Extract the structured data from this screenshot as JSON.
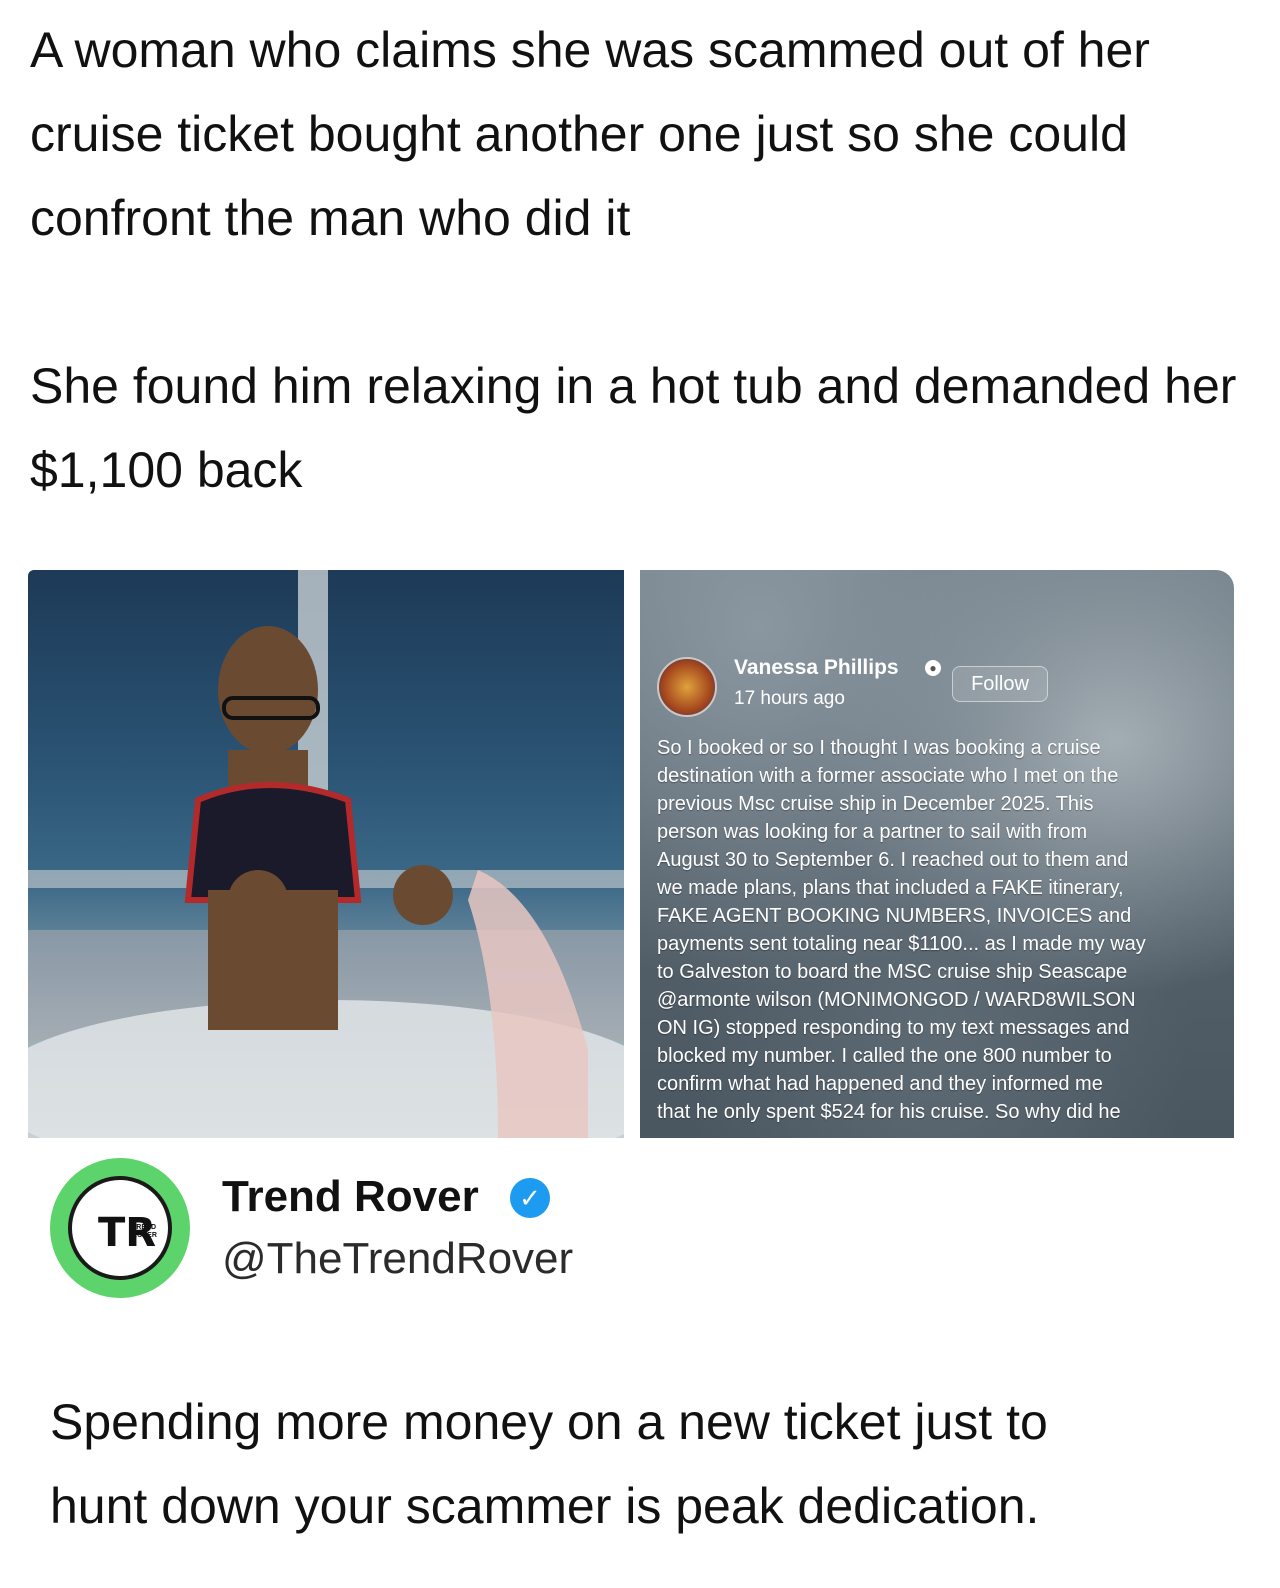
{
  "headline": {
    "paragraph1": "A woman who claims she was scammed out of her cruise ticket bought another one just so she could confront the man who did it",
    "paragraph2": "She found him relaxing in a hot tub and demanded her $1,100 back"
  },
  "facebook_post": {
    "author": "Vanessa Phillips",
    "visibility_icon": "globe-icon",
    "time": "17 hours ago",
    "follow_label": "Follow",
    "body": "So I booked or so I thought I was booking a cruise\ndestination with a former associate who I met on the\nprevious Msc cruise ship in December 2025. This\nperson was looking for a partner to sail with from\nAugust 30 to September 6. I reached out to them and\nwe made plans, plans that included a FAKE itinerary,\nFAKE AGENT BOOKING NUMBERS, INVOICES and\npayments sent totaling near $1100... as I made my way\nto Galveston to board the MSC cruise ship Seascape\n@armonte wilson (MONIMONGOD / WARD8WILSON\nON IG) stopped responding to my text messages and\nblocked my number. I called the one 800 number to\nconfirm what had happened and they informed me\nthat he only spent $524 for his cruise. So why did he"
  },
  "account": {
    "logo_letters": "TR",
    "logo_small_text": "TREND\nROVER",
    "name": "Trend Rover",
    "verified_icon": "verified-badge-icon",
    "handle": "@TheTrendRover",
    "accent_color": "#5dd36b",
    "verified_color": "#1d9bf0"
  },
  "tweet": {
    "text": "Spending more money on a new ticket just to\nhunt down your scammer is peak dedication."
  }
}
